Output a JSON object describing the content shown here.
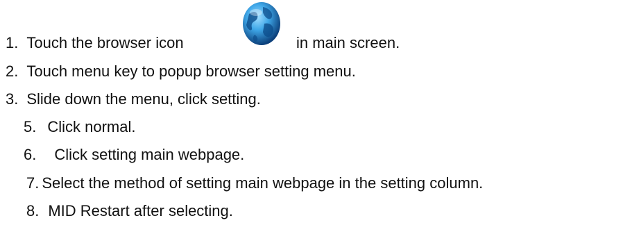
{
  "steps": [
    {
      "number": "1.",
      "text_before": "Touch the browser icon",
      "icon": "browser-globe-icon",
      "text_after": "in main screen."
    },
    {
      "number": "2.",
      "text": "Touch menu key to popup browser setting menu."
    },
    {
      "number": "3.",
      "text": "Slide down the menu, click setting."
    },
    {
      "number": "5.",
      "text": "Click normal."
    },
    {
      "number": "6.",
      "text": "Click setting main webpage."
    },
    {
      "number": "7.",
      "text": "Select the method of setting main webpage in the setting column."
    },
    {
      "number": "8.",
      "text": "MID Restart after selecting."
    }
  ],
  "colors": {
    "text": "#111111",
    "globe_dark": "#0b3f7a",
    "globe_light": "#3fa7e8"
  }
}
